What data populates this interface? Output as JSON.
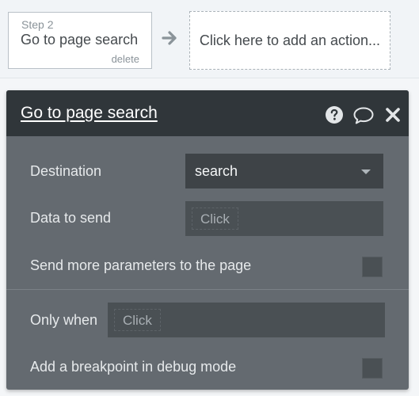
{
  "workflow": {
    "step": {
      "number_label": "Step 2",
      "title": "Go to page search",
      "delete_label": "delete"
    },
    "add_action_label": "Click here to add an action..."
  },
  "panel": {
    "title": "Go to page search",
    "fields": {
      "destination_label": "Destination",
      "destination_value": "search",
      "data_to_send_label": "Data to send",
      "data_to_send_placeholder": "Click",
      "send_more_params_label": "Send more parameters to the page",
      "send_more_params_checked": false,
      "only_when_label": "Only when",
      "only_when_placeholder": "Click",
      "breakpoint_label": "Add a breakpoint in debug mode",
      "breakpoint_checked": false
    }
  },
  "icons": {
    "arrow": "arrow-right-icon",
    "help": "question-circle-icon",
    "comment": "speech-bubble-icon",
    "close": "close-x-icon"
  },
  "colors": {
    "panel_header": "#30363a",
    "panel_body": "#646a70",
    "input_bg": "#4a5054",
    "dropdown_bg": "#3e4347"
  }
}
